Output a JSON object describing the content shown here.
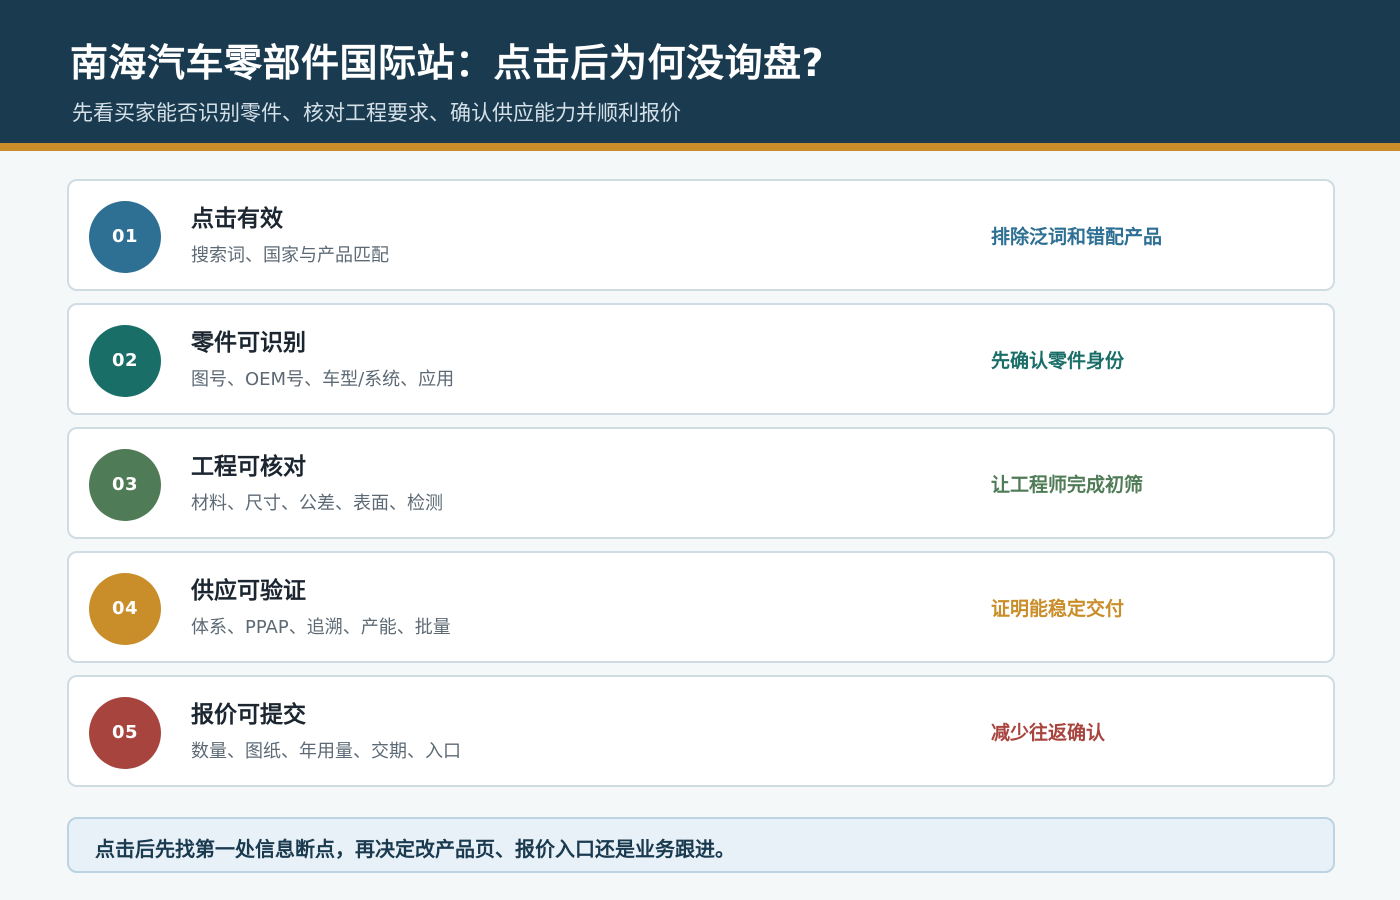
{
  "header": {
    "title": "南海汽车零部件国际站：点击后为何没询盘?",
    "subtitle": "先看买家能否识别零件、核对工程要求、确认供应能力并顺利报价"
  },
  "steps": [
    {
      "number": "01",
      "title": "点击有效",
      "desc": "搜索词、国家与产品匹配",
      "note": "排除泛词和错配产品",
      "color": "#2e6f94"
    },
    {
      "number": "02",
      "title": "零件可识别",
      "desc": "图号、OEM号、车型/系统、应用",
      "note": "先确认零件身份",
      "color": "#1a6e68"
    },
    {
      "number": "03",
      "title": "工程可核对",
      "desc": "材料、尺寸、公差、表面、检测",
      "note": "让工程师完成初筛",
      "color": "#4f7b56"
    },
    {
      "number": "04",
      "title": "供应可验证",
      "desc": "体系、PPAP、追溯、产能、批量",
      "note": "证明能稳定交付",
      "color": "#c98e2a"
    },
    {
      "number": "05",
      "title": "报价可提交",
      "desc": "数量、图纸、年用量、交期、入口",
      "note": "减少往返确认",
      "color": "#a8443e"
    }
  ],
  "callout": {
    "text": "点击后先找第一处信息断点，再决定改产品页、报价入口还是业务跟进。"
  }
}
